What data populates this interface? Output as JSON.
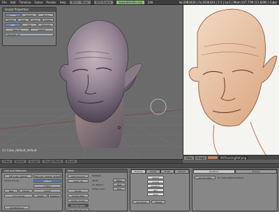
{
  "topbar": {
    "menus": [
      "File",
      "Add",
      "Timeline",
      "Game",
      "Render",
      "Help"
    ],
    "screen": "SR:1 - Mixer",
    "scene": "SCE:Scene",
    "url": "www.blender.org",
    "version": "246",
    "stats": "Ve:2083426 | Fa:2036424 | 1-1 | La:1 | Mem:127.77M (11.82M) | Cube"
  },
  "sculpt_panel": {
    "title": "Sculpt Properties",
    "row1": [
      "Draw",
      "Smooth",
      "Pinch"
    ],
    "row2": [
      "Inflate",
      "Grab",
      "Layer",
      "Flatten"
    ],
    "row3": [
      "Add",
      "Sub",
      "Airbrush"
    ],
    "row4": [
      "Size: 62",
      "Strength: 25"
    ],
    "brush_label": "default"
  },
  "viewport": {
    "object_label": "(1) Cube_default_default",
    "header_items": [
      "View",
      "Select",
      "Sculpt",
      "Sculpt Mode",
      "Brush"
    ]
  },
  "paint_header": {
    "items": [
      "View",
      "Image",
      "Brush"
    ],
    "image_name": "IM:PaintingRef.png"
  },
  "buttons": {
    "link_panel": {
      "title": "Link and Materials",
      "me_field": "ME:Cube_default",
      "ob_field": "OB:Cube_default_default",
      "vertex_groups": "Vertex Groups",
      "mat_label": "1 Mat 1",
      "default": "default",
      "buttons": [
        "New",
        "Delete",
        "Assign",
        "Copy Group",
        "Select",
        "Deselect",
        "AutoTexSpace"
      ]
    },
    "mesh_panel": {
      "title": "Mesh",
      "auto_smooth": "Auto Smooth",
      "degr": "Degr: 30",
      "center": "Center",
      "center_new": "Center New",
      "center_cursor": "Center Cursor",
      "double_sided": "Double Sided",
      "no_v_normal": "No V.Normal Flip",
      "texmesh": "TexMesh:",
      "sticky": "Sticky",
      "uv_texture": "UV Texture",
      "vertex_color": "Vertex Color",
      "make": "Make",
      "new": "New"
    },
    "multires_panel": {
      "tabs": [
        "Multires",
        "Sculpt",
        "Brush",
        "Texture"
      ],
      "levels": [
        "default",
        "cornea",
        "skeleton",
        "skin",
        "dirt1"
      ],
      "add_level": "Add Level",
      "delete": "Delete"
    },
    "modifiers_panel": {
      "title": "Modifiers",
      "shapes": "Shapes",
      "add_modifier": "Add Modifier",
      "to": "To: Cube_default_default"
    }
  }
}
